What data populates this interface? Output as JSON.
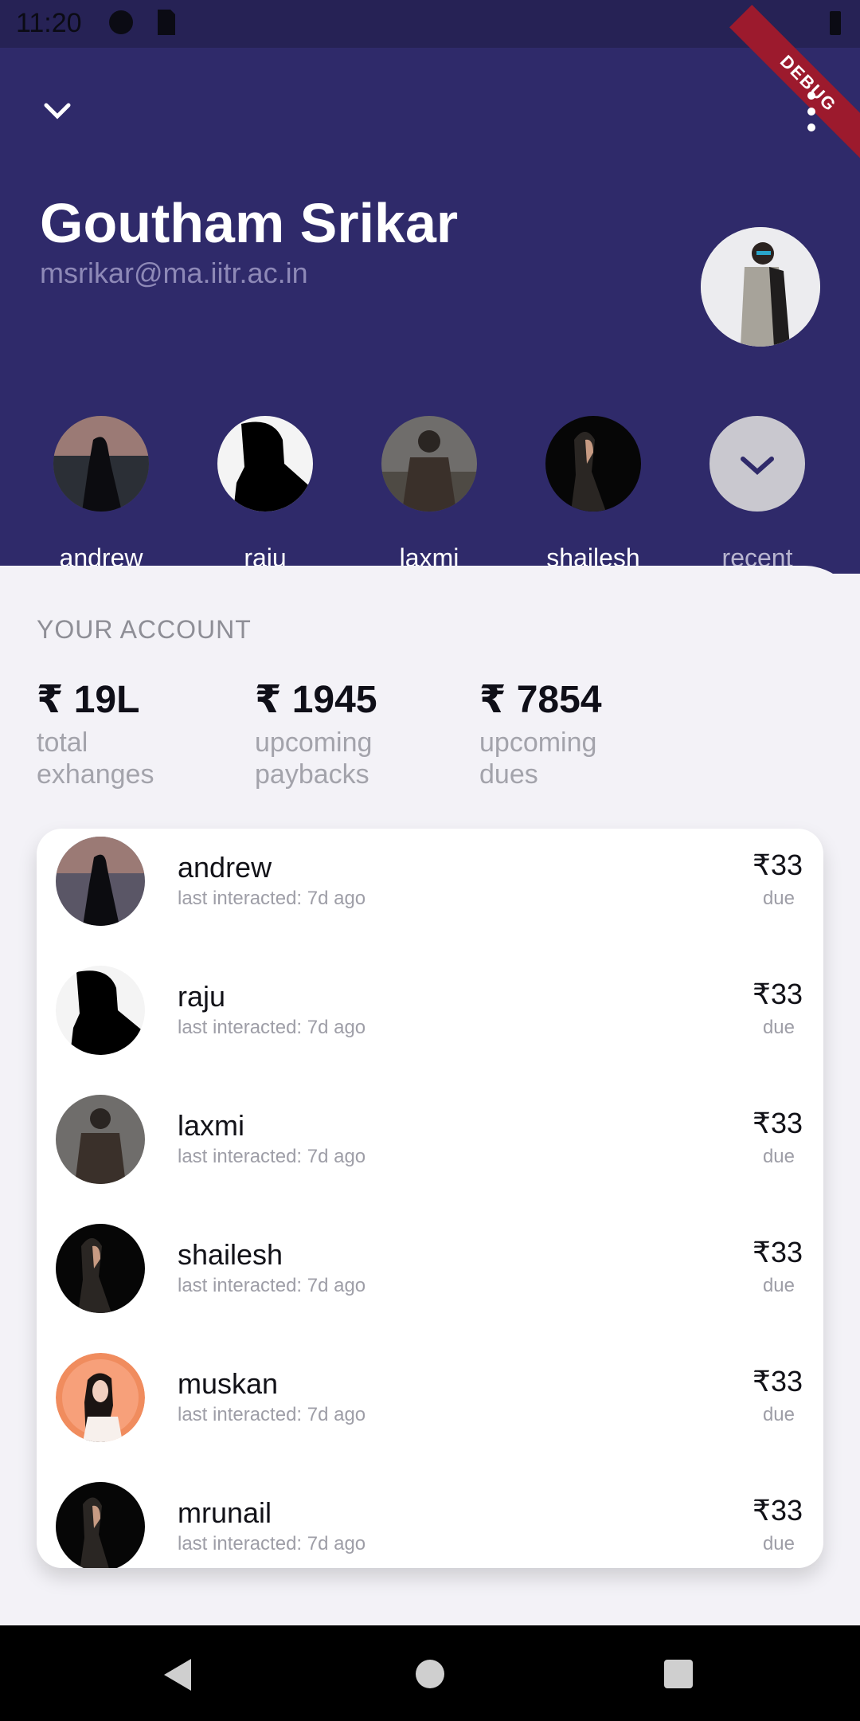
{
  "statusbar": {
    "time": "11:20"
  },
  "debug_banner": "DEBUG",
  "header": {
    "name": "Goutham Srikar",
    "email": "msrikar@ma.iitr.ac.in"
  },
  "contacts": [
    {
      "label": "andrew"
    },
    {
      "label": "raju"
    },
    {
      "label": "laxmi"
    },
    {
      "label": "shailesh"
    },
    {
      "label": "recent"
    }
  ],
  "account": {
    "section_title": "YOUR ACCOUNT",
    "stats": [
      {
        "value": "₹ 19L",
        "label1": "total",
        "label2": "exhanges"
      },
      {
        "value": "₹ 1945",
        "label1": "upcoming",
        "label2": "paybacks"
      },
      {
        "value": "₹ 7854",
        "label1": "upcoming",
        "label2": "dues"
      }
    ]
  },
  "list": [
    {
      "name": "andrew",
      "sub": "last interacted: 7d ago",
      "amount": "₹33",
      "status": "due"
    },
    {
      "name": "raju",
      "sub": "last interacted: 7d ago",
      "amount": "₹33",
      "status": "due"
    },
    {
      "name": "laxmi",
      "sub": "last interacted: 7d ago",
      "amount": "₹33",
      "status": "due"
    },
    {
      "name": "shailesh",
      "sub": "last interacted: 7d ago",
      "amount": "₹33",
      "status": "due"
    },
    {
      "name": "muskan",
      "sub": "last interacted: 7d ago",
      "amount": "₹33",
      "status": "due"
    },
    {
      "name": "mrunail",
      "sub": "last interacted: 7d ago",
      "amount": "₹33",
      "status": "due"
    }
  ],
  "icons": {
    "collapse": "chevron-down-icon",
    "more": "more-vert-icon",
    "recent": "chevron-down-icon",
    "nav_back": "back-triangle-icon",
    "nav_home": "home-circle-icon",
    "nav_recent": "recent-square-icon"
  }
}
